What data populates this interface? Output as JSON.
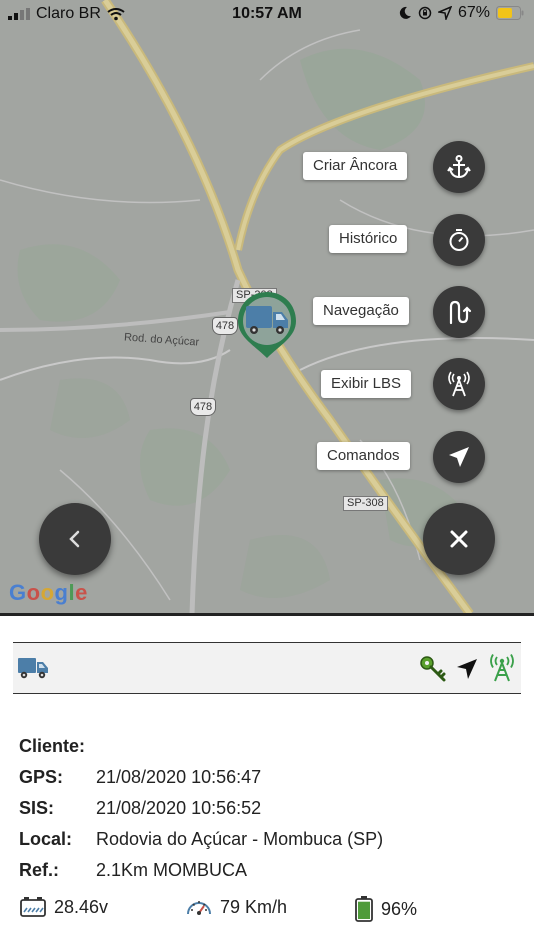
{
  "status_bar": {
    "carrier": "Claro BR",
    "time": "10:57 AM",
    "battery": "67%"
  },
  "map": {
    "road_labels": {
      "rod_acucar": "Rod. do Açúcar",
      "sp308_top": "SP-308",
      "sp308_bottom": "SP-308",
      "shield_478_a": "478",
      "shield_478_b": "478"
    },
    "google": {
      "g1": "G",
      "o1": "o",
      "o2": "o",
      "g2": "g",
      "l": "l",
      "e": "e"
    }
  },
  "actions": {
    "criar_ancora": "Criar Âncora",
    "historico": "Histórico",
    "navegacao": "Navegação",
    "exibir_lbs": "Exibir LBS",
    "comandos": "Comandos"
  },
  "info": {
    "cliente_label": "Cliente:",
    "cliente_value": "",
    "gps_label": "GPS:",
    "gps_value": "21/08/2020 10:56:47",
    "sis_label": "SIS:",
    "sis_value": "21/08/2020 10:56:52",
    "local_label": "Local:",
    "local_value": "Rodovia do Açúcar - Mombuca (SP)",
    "ref_label": "Ref.:",
    "ref_value": "2.1Km MOMBUCA"
  },
  "stats": {
    "voltage": "28.46v",
    "speed": "79 Km/h",
    "battery": "96%",
    "battery_level": 0.96
  },
  "colors": {
    "map_bg": "#a2a5a1",
    "fab": "#3a3a3a",
    "marker_green": "#2e7d4f",
    "truck_blue": "#4c7ea8",
    "key_green": "#5aa02c"
  }
}
